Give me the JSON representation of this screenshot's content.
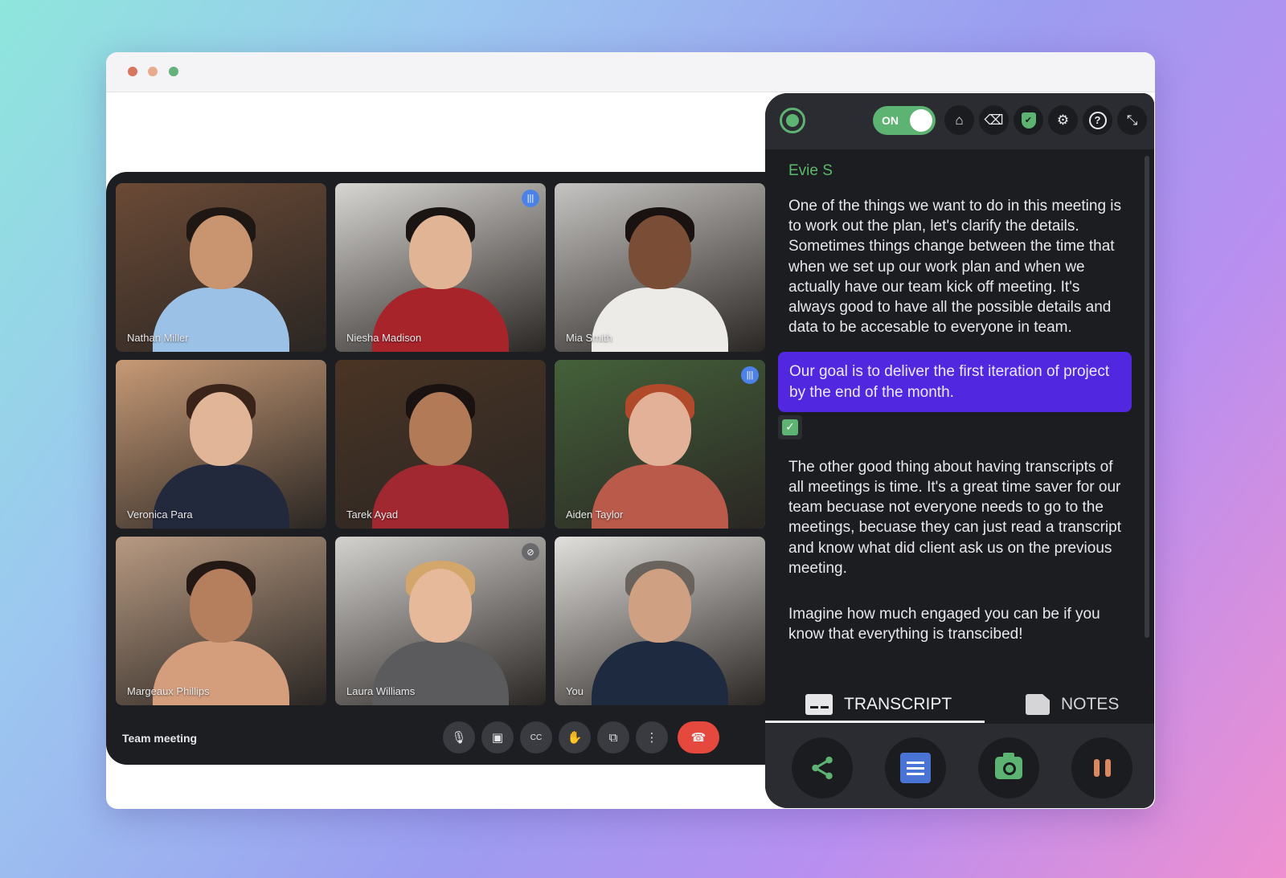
{
  "window": {
    "traffic_lights": [
      "close",
      "minimize",
      "maximize"
    ]
  },
  "meeting": {
    "title": "Team meeting",
    "participants": [
      {
        "name": "Nathan Miller",
        "status": "none",
        "bg": "#6b4a36",
        "skin": "#c99570",
        "hair": "#1e1714",
        "shirt": "#9cc1e6"
      },
      {
        "name": "Niesha Madison",
        "status": "speaking",
        "bg": "#d8d6d2",
        "skin": "#e0b494",
        "hair": "#1a1412",
        "shirt": "#a8242b"
      },
      {
        "name": "Mia Smith",
        "status": "none",
        "bg": "#c6c4c2",
        "skin": "#7a4e36",
        "hair": "#1a1210",
        "shirt": "#ecebe8"
      },
      {
        "name": "Veronica Para",
        "status": "none",
        "bg": "#c79a76",
        "skin": "#e1b597",
        "hair": "#3a241a",
        "shirt": "#23293d"
      },
      {
        "name": "Tarek Ayad",
        "status": "none",
        "bg": "#4a3424",
        "skin": "#b27a56",
        "hair": "#1a1210",
        "shirt": "#a12830"
      },
      {
        "name": "Aiden Taylor",
        "status": "speaking",
        "bg": "#44613a",
        "skin": "#e3b198",
        "hair": "#b14a2a",
        "shirt": "#b95a4b"
      },
      {
        "name": "Margeaux Phillips",
        "status": "none",
        "bg": "#b89a82",
        "skin": "#b57e5c",
        "hair": "#241814",
        "shirt": "#d49e7d"
      },
      {
        "name": "Laura Williams",
        "status": "muted",
        "bg": "#d4d2cf",
        "skin": "#e7b99b",
        "hair": "#d3a66c",
        "shirt": "#5b5b5e"
      },
      {
        "name": "You",
        "status": "none",
        "bg": "#e2e0dc",
        "skin": "#d0a082",
        "hair": "#6a625c",
        "shirt": "#1e2a40"
      }
    ],
    "controls": [
      {
        "name": "mic",
        "icon": "🎙"
      },
      {
        "name": "camera",
        "icon": "▣"
      },
      {
        "name": "captions",
        "icon": "CC"
      },
      {
        "name": "raise-hand",
        "icon": "✋"
      },
      {
        "name": "present",
        "icon": "⧉"
      },
      {
        "name": "more",
        "icon": "⋮"
      },
      {
        "name": "end-call",
        "icon": "☎"
      }
    ]
  },
  "widget": {
    "toggle_label": "ON",
    "toggle_state": true,
    "header_icons": [
      {
        "name": "home",
        "glyph": "⌂"
      },
      {
        "name": "eraser",
        "glyph": "⌫"
      },
      {
        "name": "shield",
        "glyph": "✔"
      },
      {
        "name": "settings",
        "glyph": "⚙"
      },
      {
        "name": "help",
        "glyph": "?"
      },
      {
        "name": "minimize",
        "glyph": "⤡"
      }
    ],
    "speaker": "Evie S",
    "paragraphs": [
      "One of the things we want to do in this meeting is to work out the plan, let's clarify the details. Sometimes things change between the time that when we set up our work plan and when we actually have our team kick off meeting. It's always good to have all the possible details and data to be accesable to everyone in team.",
      "Our goal is to deliver the first iteration of project by the end of the month.",
      "The other good thing about having transcripts of all meetings is time. It's a great time saver for our team becuase not everyone needs to go to the meetings, becuase they can just read a transcript and know what did client ask us on the previous meeting.",
      "Imagine how much engaged you can be if you know that everything is transcibed!"
    ],
    "highlight_checked": true,
    "tabs": [
      {
        "label": "TRANSCRIPT",
        "active": true
      },
      {
        "label": "NOTES",
        "active": false
      }
    ],
    "footer_buttons": [
      "share",
      "document",
      "camera",
      "pause"
    ],
    "colors": {
      "accent_green": "#5db372",
      "highlight_purple": "#5227e0",
      "doc_blue": "#4a73d6",
      "pause_orange": "#d9885f",
      "end_call_red": "#e5483d"
    }
  }
}
